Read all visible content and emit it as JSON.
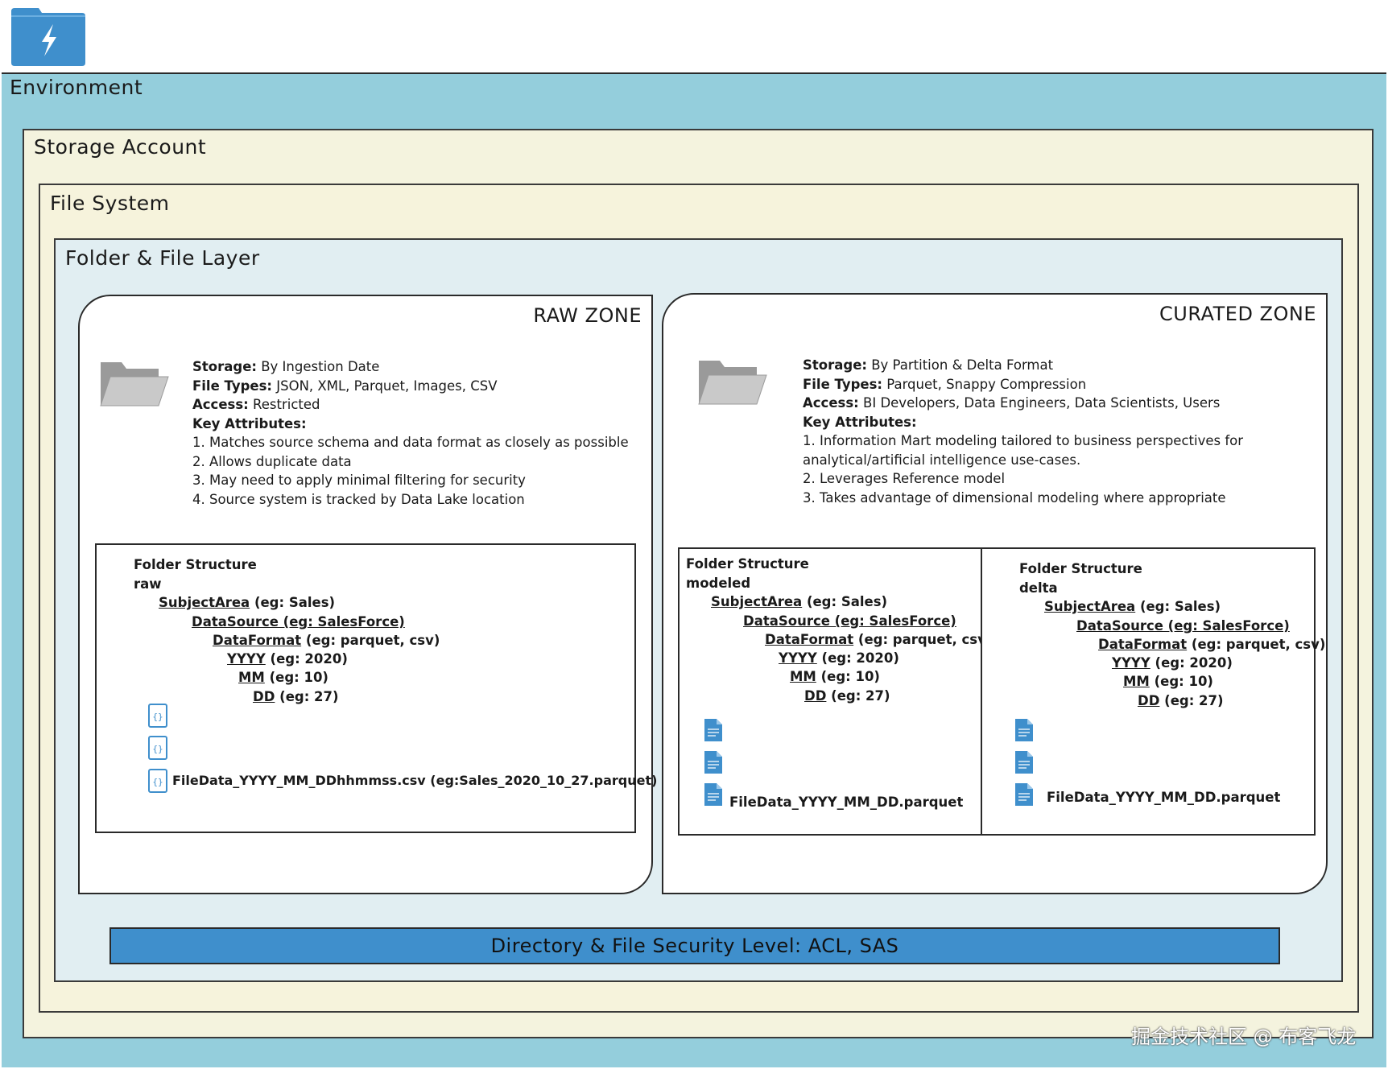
{
  "layers": {
    "environment": "Environment",
    "storage_account": "Storage Account",
    "file_system": "File System",
    "folder_file_layer": "Folder & File Layer"
  },
  "raw_zone": {
    "title": "RAW ZONE",
    "storage_label": "Storage:",
    "storage_value": " By Ingestion Date",
    "filetypes_label": "File Types:",
    "filetypes_value": " JSON, XML, Parquet, Images, CSV",
    "access_label": "Access:",
    "access_value": " Restricted",
    "key_label": "Key Attributes:",
    "attributes": [
      "1. Matches source schema and data format as closely as possible",
      "2. Allows duplicate data",
      "3. May need to apply minimal filtering for security",
      "4. Source system is tracked by Data Lake location"
    ],
    "folder_structure": {
      "heading": "Folder Structure",
      "root": "raw",
      "subject_key": "SubjectArea",
      "subject_rest": " (eg: Sales)",
      "datasource": "DataSource (eg: SalesForce)",
      "format_key": "DataFormat",
      "format_rest": " (eg: parquet, csv)",
      "yyyy_key": "YYYY",
      "yyyy_rest": " (eg: 2020)",
      "mm_key": "MM",
      "mm_rest": " (eg: 10)",
      "dd_key": "DD",
      "dd_rest": " (eg: 27)",
      "file_name": "FileData_YYYY_MM_DDhhmmss.csv (eg:Sales_2020_10_27.parquet)"
    }
  },
  "curated_zone": {
    "title": "CURATED ZONE",
    "storage_label": "Storage:",
    "storage_value": " By Partition & Delta Format",
    "filetypes_label": "File Types:",
    "filetypes_value": " Parquet, Snappy Compression",
    "access_label": "Access:",
    "access_value": " BI Developers, Data Engineers, Data Scientists, Users",
    "key_label": "Key Attributes:",
    "attributes": [
      "1. Information Mart modeling tailored to business perspectives for",
      "analytical/artificial intelligence use-cases.",
      "2. Leverages Reference model",
      "3. Takes advantage of dimensional modeling where appropriate"
    ],
    "modeled": {
      "heading": "Folder Structure",
      "root": "modeled",
      "subject_key": "SubjectArea",
      "subject_rest": " (eg: Sales)",
      "datasource": "DataSource (eg: SalesForce)",
      "format_key": "DataFormat",
      "format_rest": " (eg: parquet, csv)",
      "yyyy_key": "YYYY",
      "yyyy_rest": " (eg: 2020)",
      "mm_key": "MM",
      "mm_rest": " (eg: 10)",
      "dd_key": "DD",
      "dd_rest": " (eg: 27)",
      "file_name": "FileData_YYYY_MM_DD.parquet"
    },
    "delta": {
      "heading": "Folder Structure",
      "root": "delta",
      "subject_key": "SubjectArea",
      "subject_rest": " (eg: Sales)",
      "datasource": "DataSource (eg: SalesForce)",
      "format_key": "DataFormat",
      "format_rest": " (eg: parquet, csv)",
      "yyyy_key": "YYYY",
      "yyyy_rest": " (eg: 2020)",
      "mm_key": "MM",
      "mm_rest": " (eg: 10)",
      "dd_key": "DD",
      "dd_rest": " (eg: 27)",
      "file_name": "FileData_YYYY_MM_DD.parquet"
    }
  },
  "security_bar": "Directory & File Security Level: ACL, SAS",
  "watermark": "掘金技术社区 @ 布客飞龙",
  "icons": {
    "app": "lightning-folder-icon",
    "zone_folder": "folder-open-icon",
    "raw_file": "json-file-icon",
    "curated_file": "document-file-icon"
  },
  "colors": {
    "environment": "#94cedc",
    "storage": "#f4f3de",
    "folder_layer": "#e1eef2",
    "security_bar": "#3f8fcc",
    "icon_blue": "#3f8fcc"
  }
}
